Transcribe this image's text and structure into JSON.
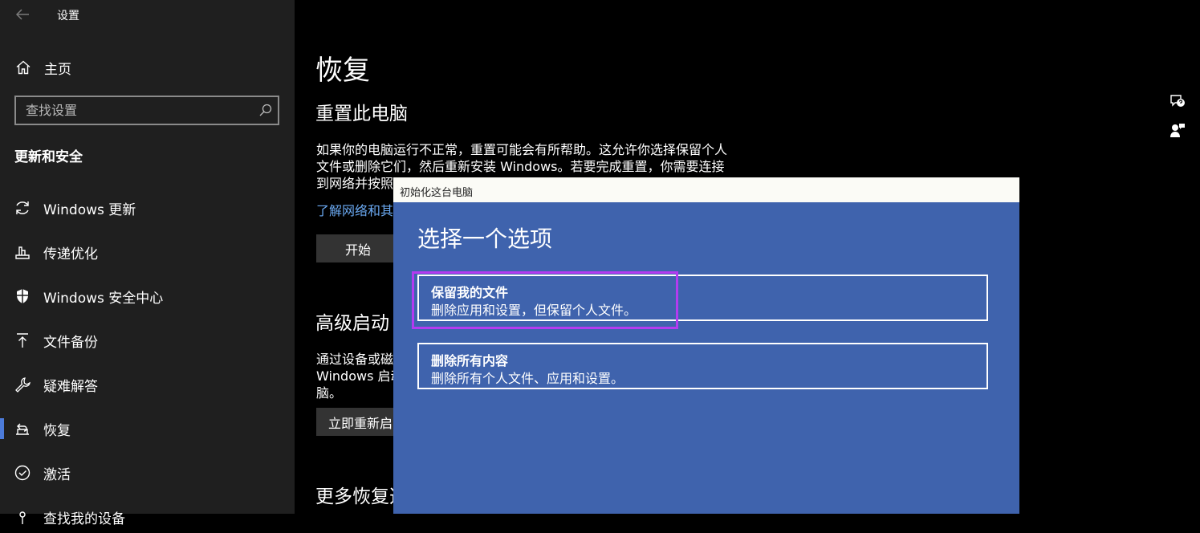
{
  "window": {
    "title": "设置"
  },
  "sidebar": {
    "home_label": "主页",
    "search": {
      "placeholder": "查找设置"
    },
    "section_title": "更新和安全",
    "items": [
      {
        "label": "Windows 更新",
        "icon": "sync-icon"
      },
      {
        "label": "传递优化",
        "icon": "delivery-optimization-icon"
      },
      {
        "label": "Windows 安全中心",
        "icon": "shield-icon"
      },
      {
        "label": "文件备份",
        "icon": "backup-upload-icon"
      },
      {
        "label": "疑难解答",
        "icon": "wrench-icon"
      },
      {
        "label": "恢复",
        "icon": "recovery-icon",
        "active": true
      },
      {
        "label": "激活",
        "icon": "check-circle-icon"
      },
      {
        "label": "查找我的设备",
        "icon": "find-device-icon"
      }
    ],
    "accent": "#4c7bd9"
  },
  "main": {
    "title": "恢复",
    "reset": {
      "heading": "重置此电脑",
      "line1": "如果你的电脑运行不正常，重置可能会有所帮助。这允许你选择保留个人",
      "line2": "文件或删除它们，然后重新安装 Windows。若要完成重置，你需要连接",
      "line3": "到网络并按照",
      "link": "了解网络和其",
      "button": "开始"
    },
    "advanced": {
      "heading": "高级启动",
      "line1": "通过设备或磁",
      "line2": "Windows 启动",
      "line3": "脑。",
      "button": "立即重新启"
    },
    "more": {
      "heading": "更多恢复选"
    }
  },
  "dialog": {
    "title": "初始化这台电脑",
    "heading": "选择一个选项",
    "options": [
      {
        "title": "保留我的文件",
        "desc": "删除应用和设置，但保留个人文件。"
      },
      {
        "title": "删除所有内容",
        "desc": "删除所有个人文件、应用和设置。"
      }
    ],
    "bg_color": "#3f63ad",
    "highlight_color": "#b33bf0"
  }
}
